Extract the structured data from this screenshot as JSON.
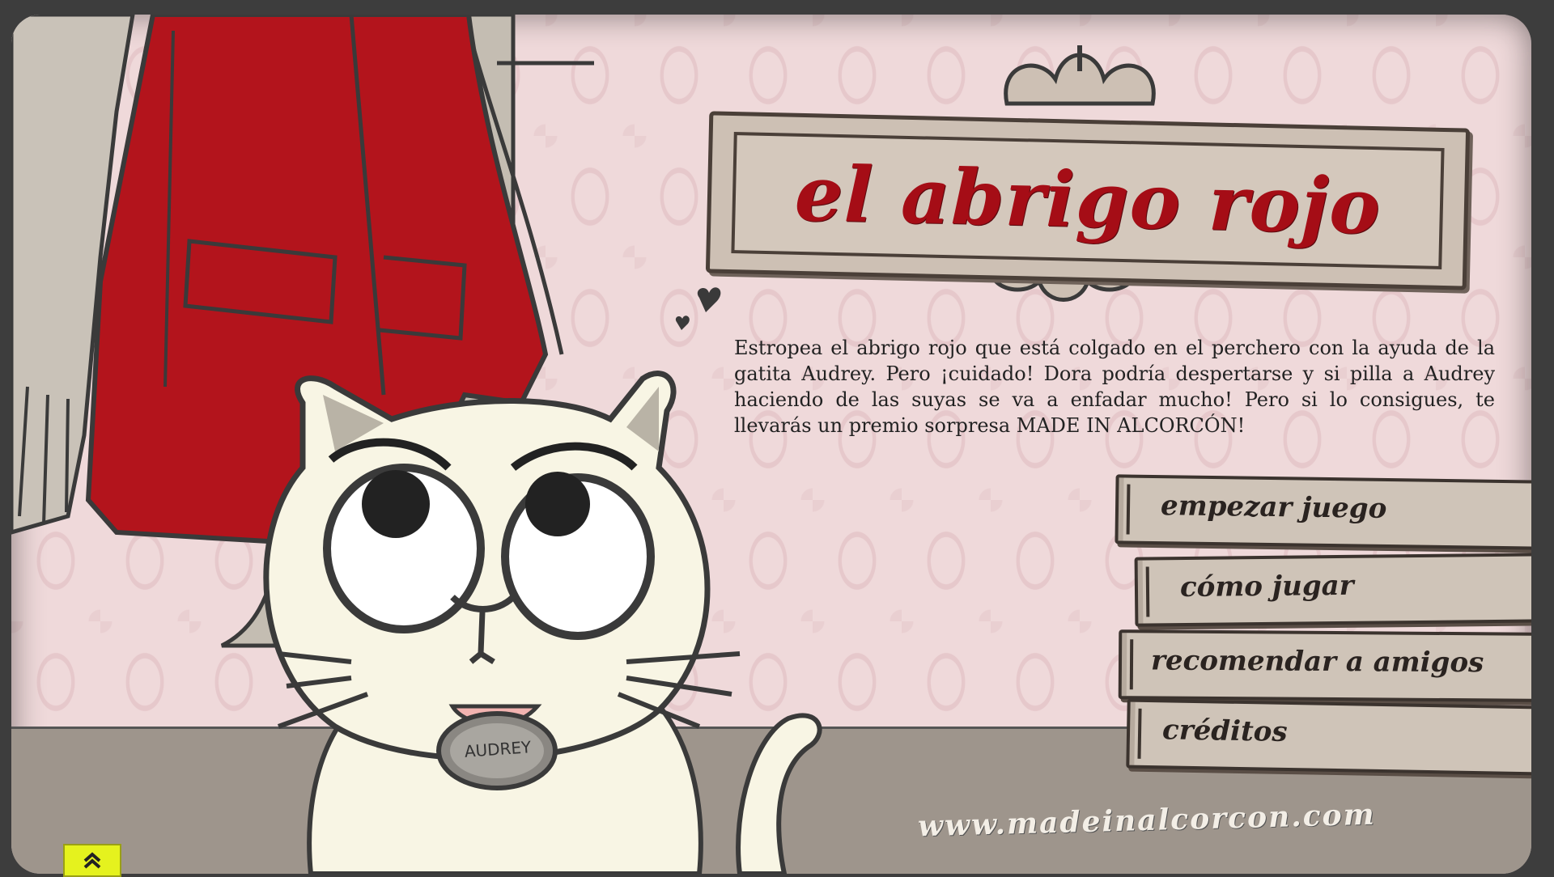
{
  "game": {
    "title": "el abrigo rojo",
    "description": "Estropea el abrigo rojo que está colgado en el perchero con la ayuda de la gatita Audrey. Pero ¡cuidado! Dora podría despertarse y si pilla a Audrey haciendo de las suyas se va a enfadar mucho! Pero si lo consigues, te llevarás un premio sorpresa MADE IN ALCORCÓN!",
    "cat_tag": "AUDREY",
    "website": "www.madeinalcorcon.com"
  },
  "menu": {
    "start": "empezar juego",
    "how_to": "cómo jugar",
    "recommend": "recomendar a amigos",
    "credits": "créditos"
  },
  "colors": {
    "coat": "#b3141c",
    "title_text": "#a50d16",
    "wallpaper": "#efd9da",
    "plaque": "#cdc0b4",
    "cat": "#f8f5e4",
    "expand_button": "#e5f21e"
  },
  "icons": {
    "expand": "double-chevron-up-icon",
    "hearts": "hearts-icon"
  }
}
